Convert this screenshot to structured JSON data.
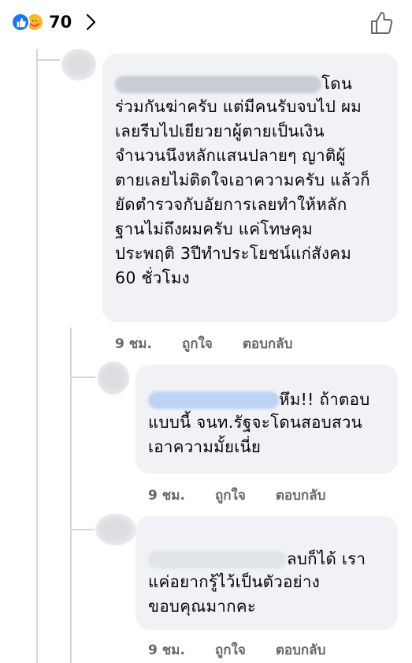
{
  "reactions": {
    "count": "70",
    "icons": [
      "thumbs-up",
      "care-hug"
    ],
    "colors": {
      "like": "#1877f2",
      "care": "#f7b928"
    }
  },
  "comments": [
    {
      "lines": [
        "โดน",
        "ร่วมกันฆ่าครับ แต่มีคนรับจบไป ผม",
        "เลยรีบไปเยียวยาผู้ตายเป็นเงิน",
        "จำนวนนึงหลักแสนปลายๆ ญาติผู้",
        "ตายเลยไม่ติดใจเอาความครับ แล้วก็",
        "ยัดตำรวจกับอัยการเลยทำให้หลัก",
        "ฐานไม่ถึงผมครับ แค่โทษคุม",
        "ประพฤติ 3ปีทำประโยชน์แก่สังคม",
        "60 ชั่วโมง"
      ],
      "time": "9 ชม.",
      "like": "ถูกใจ",
      "reply": "ตอบกลับ"
    },
    {
      "lines": [
        "หึม!! ถ้าตอบ",
        "แบบนี้ จนท.รัฐจะโดนสอบสวน",
        "เอาความมั้ยเนี่ย"
      ],
      "time": "9 ชม.",
      "like": "ถูกใจ",
      "reply": "ตอบกลับ"
    },
    {
      "lines": [
        "ลบก็ได้ เรา",
        "แค่อยากรู้ไว้เป็นตัวอย่าง",
        "ขอบคุณมากคะ"
      ],
      "time": "9 ชม.",
      "like": "ถูกใจ",
      "reply": "ตอบกลับ"
    }
  ]
}
